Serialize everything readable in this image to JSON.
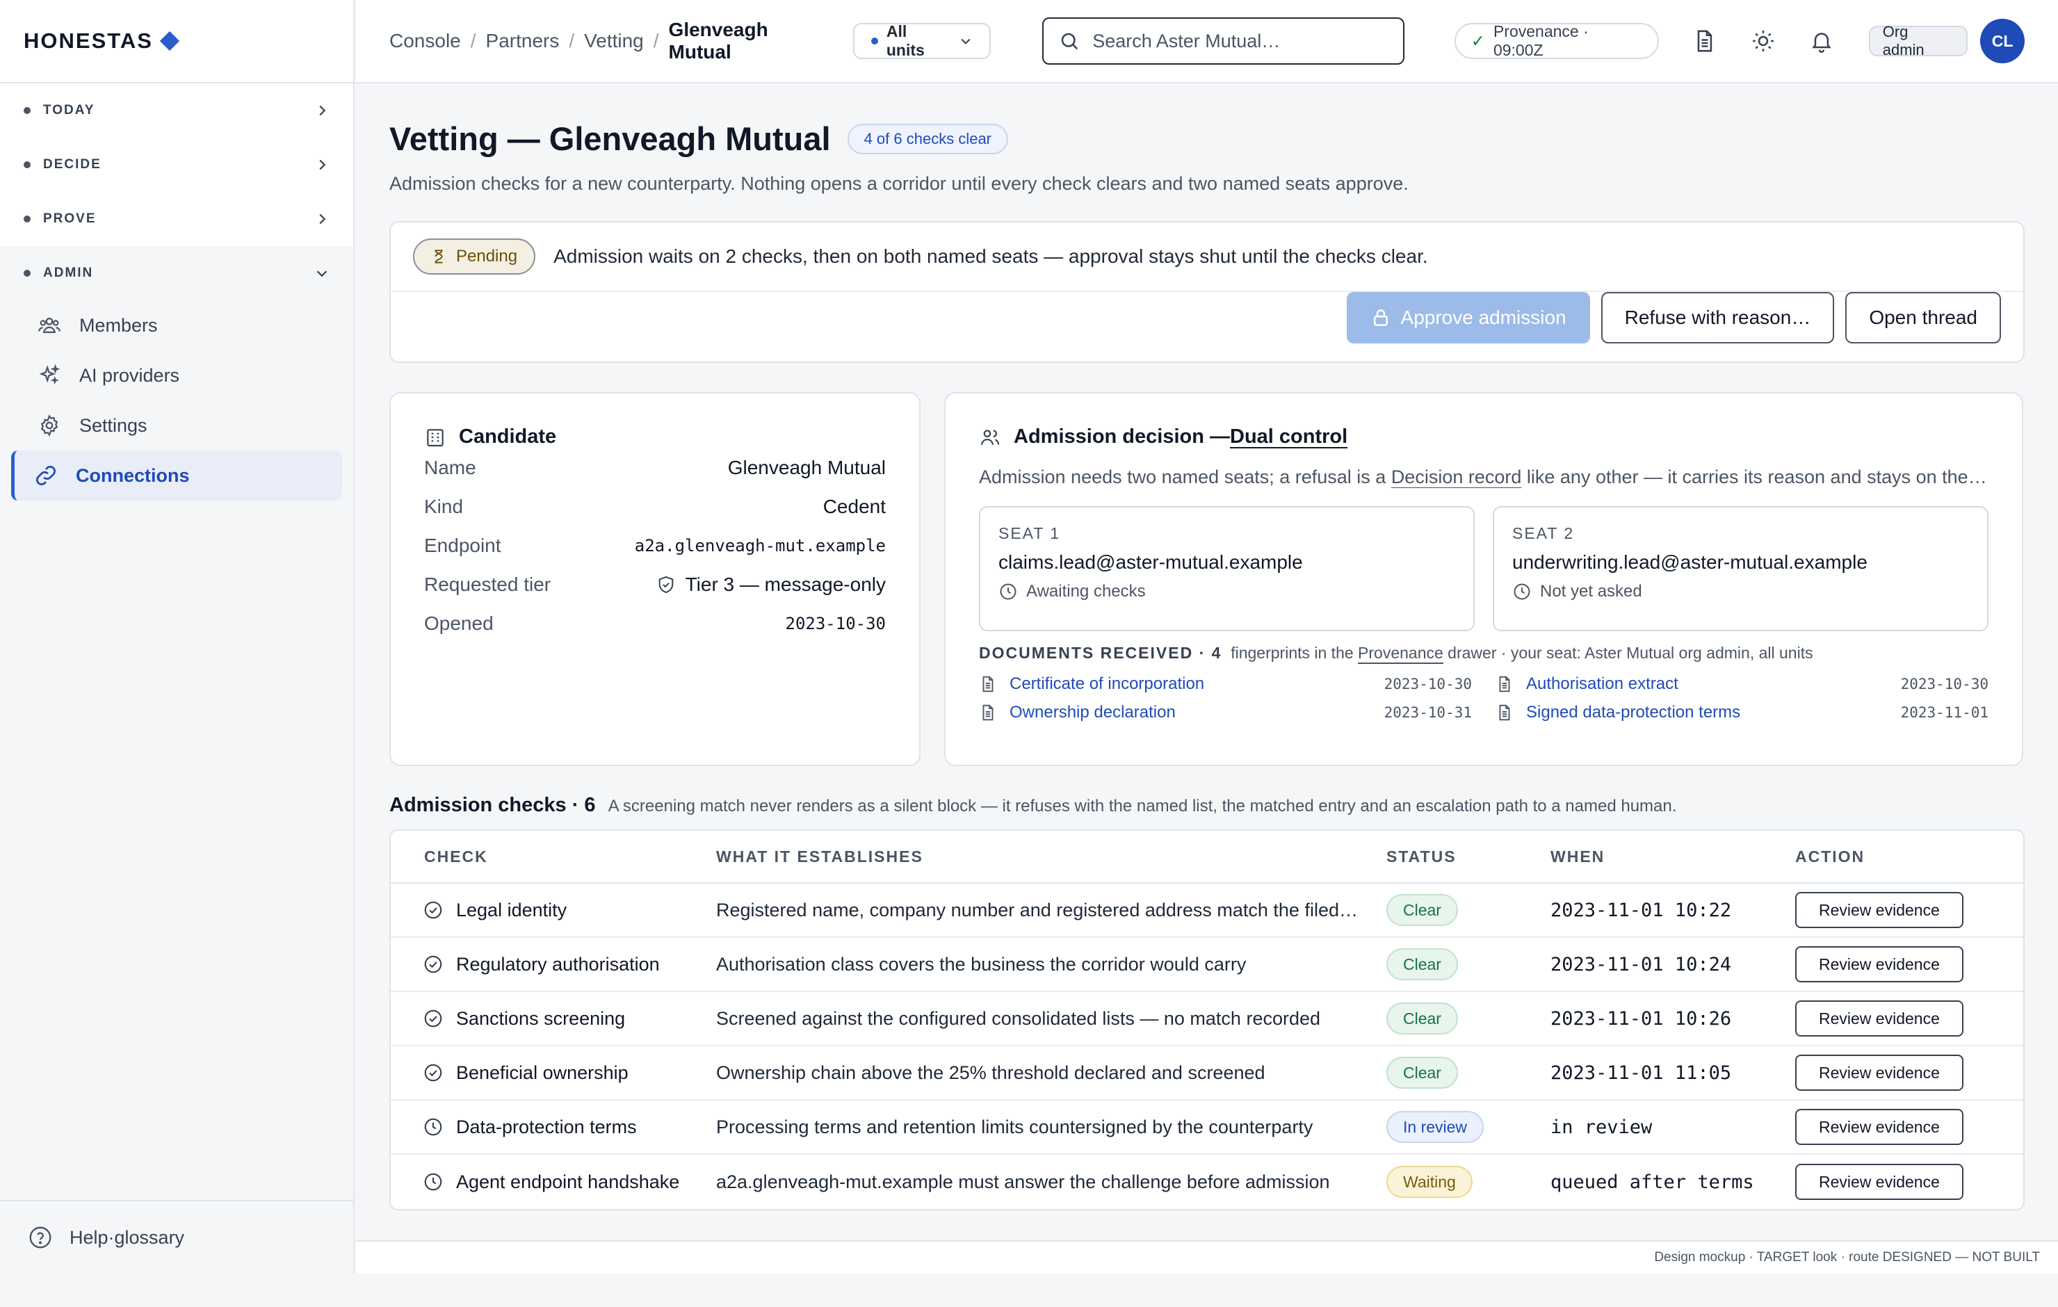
{
  "brand": {
    "name": "HONESTAS",
    "accent": "#2b5cd0"
  },
  "sidebar": {
    "groups": [
      {
        "label": "TODAY"
      },
      {
        "label": "DECIDE"
      },
      {
        "label": "PROVE"
      },
      {
        "label": "ADMIN"
      }
    ],
    "admin_items": [
      {
        "label": "Members",
        "icon": "members-icon"
      },
      {
        "label": "AI providers",
        "icon": "sparkle-icon"
      },
      {
        "label": "Settings",
        "icon": "gear-icon"
      },
      {
        "label": "Connections",
        "icon": "link-icon",
        "active": true
      }
    ],
    "footer_label": "Help·glossary"
  },
  "topbar": {
    "breadcrumbs": [
      "Console",
      "Partners",
      "Vetting",
      "Glenveagh Mutual"
    ],
    "unit_select": "All units",
    "search_placeholder": "Search Aster Mutual…",
    "provenance": "Provenance · 09:00Z",
    "role": "Org admin",
    "avatar_initials": "CL"
  },
  "page": {
    "title": "Vetting — Glenveagh Mutual",
    "badge": "4 of 6 checks clear",
    "subtitle": "Admission checks for a new counterparty. Nothing opens a corridor until every check clears and two named seats approve."
  },
  "banner": {
    "status": "Pending",
    "message": "Admission waits on 2 checks, then on both named seats — approval stays shut until the checks clear.",
    "approve_label": "Approve admission",
    "refuse_label": "Refuse with reason…",
    "thread_label": "Open thread"
  },
  "candidate": {
    "title": "Candidate",
    "rows": [
      {
        "key": "Name",
        "value": "Glenveagh Mutual"
      },
      {
        "key": "Kind",
        "value": "Cedent"
      },
      {
        "key": "Endpoint",
        "value": "a2a.glenveagh-mut.example"
      },
      {
        "key": "Requested tier",
        "value": "Tier 3 — message-only"
      },
      {
        "key": "Opened",
        "value": "2023-10-30"
      }
    ]
  },
  "decision": {
    "title_prefix": "Admission decision — ",
    "title_link": "Dual control",
    "desc_a": "Admission needs two named seats; a refusal is a ",
    "desc_link": "Decision record",
    "desc_b": " like any other — it carries its reason and stays on the record.",
    "seats": [
      {
        "label": "SEAT 1",
        "email": "claims.lead@aster-mutual.example",
        "status": "Awaiting checks"
      },
      {
        "label": "SEAT 2",
        "email": "underwriting.lead@aster-mutual.example",
        "status": "Not yet asked"
      }
    ],
    "docs_label": "DOCUMENTS RECEIVED · 4",
    "docs_note_a": "fingerprints in the ",
    "docs_note_link": "Provenance",
    "docs_note_b": " drawer · your seat: Aster Mutual org admin, all units",
    "documents": [
      {
        "name": "Certificate of incorporation",
        "date": "2023-10-30"
      },
      {
        "name": "Authorisation extract",
        "date": "2023-10-30"
      },
      {
        "name": "Ownership declaration",
        "date": "2023-10-31"
      },
      {
        "name": "Signed data-protection terms",
        "date": "2023-11-01"
      }
    ]
  },
  "checks": {
    "title": "Admission checks · 6",
    "note": "A screening match never renders as a silent block — it refuses with the named list, the matched entry and an escalation path to a named human.",
    "headers": [
      "CHECK",
      "WHAT IT ESTABLISHES",
      "STATUS",
      "WHEN",
      "ACTION"
    ],
    "action_label": "Review evidence",
    "rows": [
      {
        "check": "Legal identity",
        "establishes": "Registered name, company number and registered address match the filed certificate",
        "status": "Clear",
        "kind": "clear",
        "when": "2023-11-01 10:22",
        "icon": "check-circle-icon"
      },
      {
        "check": "Regulatory authorisation",
        "establishes": "Authorisation class covers the business the corridor would carry",
        "status": "Clear",
        "kind": "clear",
        "when": "2023-11-01 10:24",
        "icon": "check-circle-icon"
      },
      {
        "check": "Sanctions screening",
        "establishes": "Screened against the configured consolidated lists — no match recorded",
        "status": "Clear",
        "kind": "clear",
        "when": "2023-11-01 10:26",
        "icon": "check-circle-icon"
      },
      {
        "check": "Beneficial ownership",
        "establishes": "Ownership chain above the 25% threshold declared and screened",
        "status": "Clear",
        "kind": "clear",
        "when": "2023-11-01 11:05",
        "icon": "check-circle-icon"
      },
      {
        "check": "Data-protection terms",
        "establishes": "Processing terms and retention limits countersigned by the counterparty",
        "status": "In review",
        "kind": "review",
        "when": "in review",
        "icon": "clock-icon"
      },
      {
        "check": "Agent endpoint handshake",
        "establishes": "a2a.glenveagh-mut.example must answer the challenge before admission",
        "status": "Waiting",
        "kind": "waiting",
        "when": "queued after terms",
        "icon": "clock-icon"
      }
    ]
  },
  "footer": {
    "note": "Design mockup · TARGET look · route DESIGNED — NOT BUILT"
  }
}
